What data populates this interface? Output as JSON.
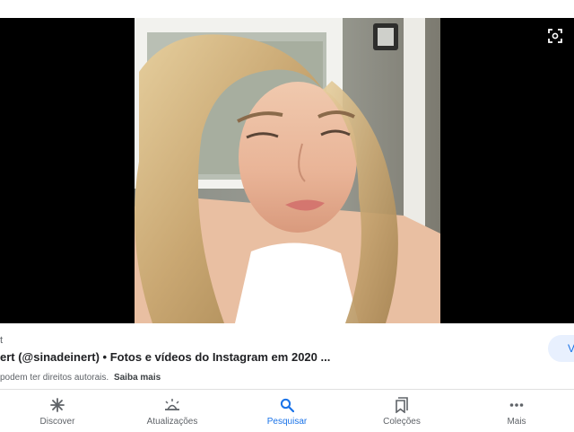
{
  "result": {
    "source": "t",
    "title": "ert (@sinadeinert) • Fotos e vídeos do Instagram em 2020 ...",
    "copyright_text": "podem ter direitos autorais.",
    "learn_more": "Saiba mais",
    "visit_label": "V"
  },
  "nav": {
    "items": [
      {
        "label": "Discover",
        "icon": "asterisk-icon"
      },
      {
        "label": "Atualizações",
        "icon": "updates-icon"
      },
      {
        "label": "Pesquisar",
        "icon": "search-icon"
      },
      {
        "label": "Coleções",
        "icon": "collections-icon"
      },
      {
        "label": "Mais",
        "icon": "more-dots-icon"
      }
    ],
    "active_index": 2
  },
  "colors": {
    "accent": "#1a73e8",
    "viewer_background": "#000000",
    "visit_button_bg": "#e8f0fe"
  }
}
